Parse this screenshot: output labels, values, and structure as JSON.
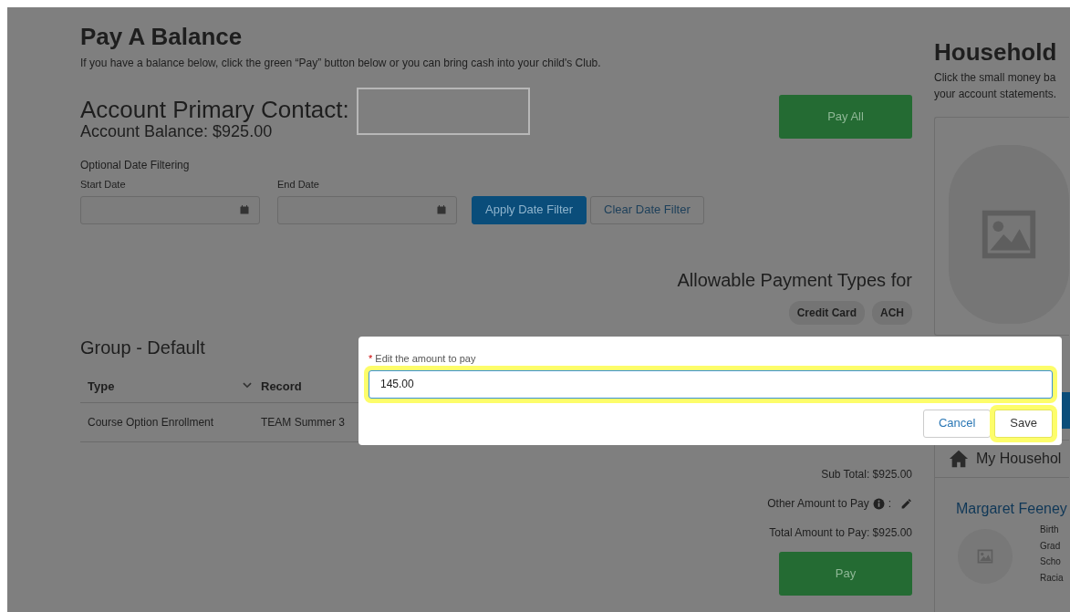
{
  "page": {
    "title": "Pay A Balance",
    "intro": "If you have a balance below, click the green “Pay” button below or you can bring cash into your child's Club."
  },
  "account": {
    "contact_label": "Account Primary Contact:",
    "balance": "Account Balance: $925.00"
  },
  "pay_all_button": "Pay All",
  "date_filter": {
    "heading": "Optional Date Filtering",
    "start_label": "Start Date",
    "end_label": "End Date",
    "apply_button": "Apply Date Filter",
    "clear_button": "Clear Date Filter"
  },
  "payment_types": {
    "heading": "Allowable Payment Types for",
    "types": [
      "Credit Card",
      "ACH"
    ]
  },
  "group": {
    "title": "Group - Default",
    "columns": [
      {
        "label": "Type",
        "dropdown": true
      },
      {
        "label": "Record"
      }
    ],
    "rows": [
      [
        "Course Option Enrollment",
        "TEAM Summer 3"
      ]
    ]
  },
  "totals": {
    "sub_total": "Sub Total: $925.00",
    "other_amount": "Other Amount to Pay",
    "other_amount_suffix": ":",
    "total": "Total Amount to Pay: $925.00"
  },
  "pay_button": "Pay",
  "household": {
    "title": "Household",
    "description": [
      "Click the small money ba",
      "your account statements."
    ],
    "card_title": "My Househol",
    "member": {
      "name": "Margaret Feeney",
      "details": [
        "Birth",
        "Grad",
        "Scho",
        "Racia"
      ]
    }
  },
  "modal": {
    "required_mark": "*",
    "label": "Edit the amount to pay",
    "value": "145.00",
    "value_highlighted": true,
    "buttons": [
      {
        "label": "Cancel",
        "kind": "secondary",
        "highlighted": false
      },
      {
        "label": "Save",
        "kind": "primary",
        "highlighted": true
      }
    ]
  }
}
